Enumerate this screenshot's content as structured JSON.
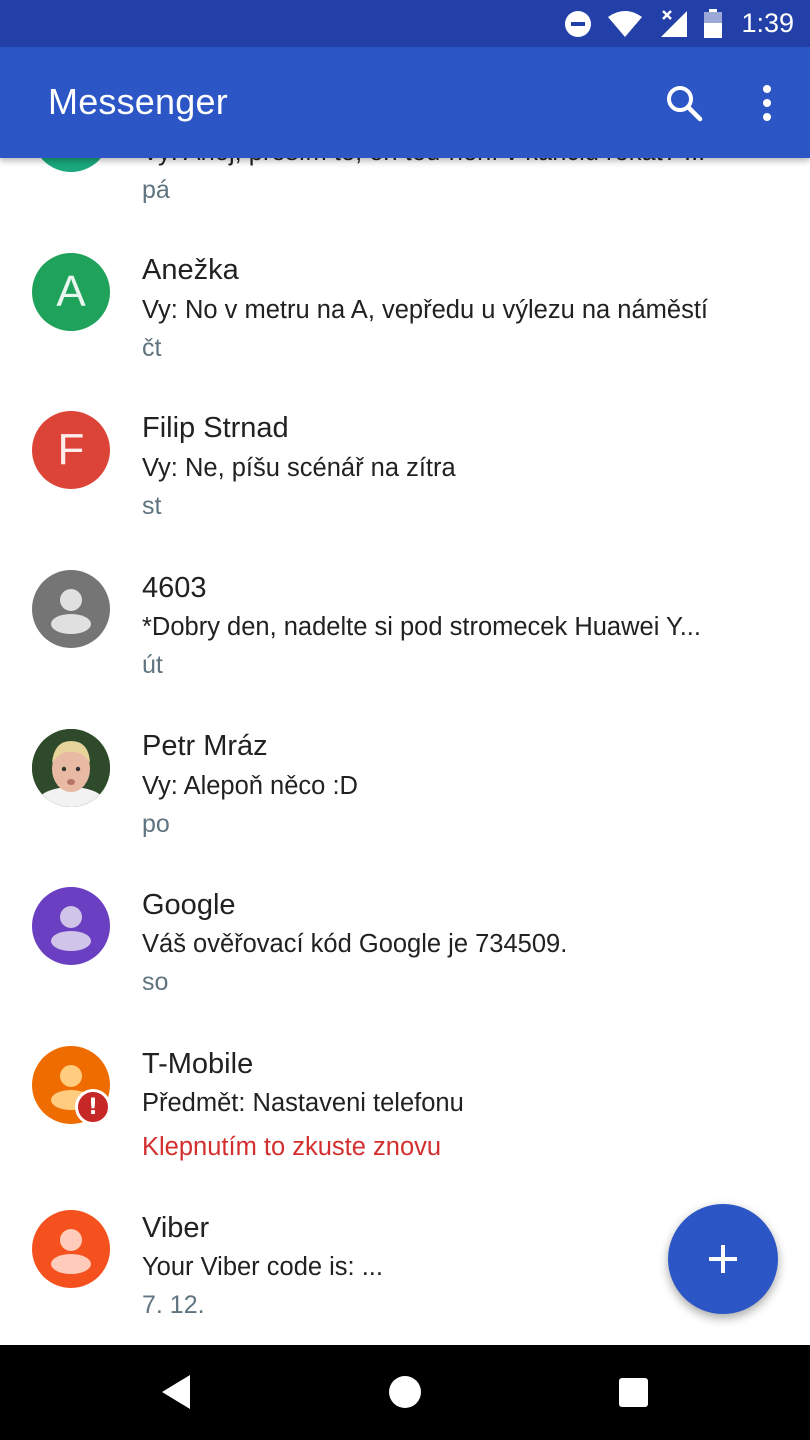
{
  "status_bar": {
    "time": "1:39",
    "icons": [
      "do-not-disturb-icon",
      "wifi-icon",
      "cell-signal-icon",
      "battery-icon"
    ]
  },
  "app_bar": {
    "title": "Messenger",
    "actions": [
      "search-icon",
      "more-vert-icon"
    ]
  },
  "conversations": [
    {
      "name": "",
      "snippet": "Vy: Ahoj, prosím tě, on teď není v kanclu řekat? ...",
      "time": "pá",
      "avatar": {
        "type": "letter",
        "letter": "",
        "color": "#1aa87c"
      }
    },
    {
      "name": "Anežka",
      "snippet": "Vy: No v metru na A, vepředu u výlezu na náměstí",
      "time": "čt",
      "avatar": {
        "type": "letter",
        "letter": "A",
        "color": "#1fa35a"
      }
    },
    {
      "name": "Filip Strnad",
      "snippet": "Vy: Ne, píšu scénář na zítra",
      "time": "st",
      "avatar": {
        "type": "letter",
        "letter": "F",
        "color": "#db4437"
      }
    },
    {
      "name": "4603",
      "snippet": "*Dobry den, nadelte si pod stromecek Huawei Y...",
      "time": "út",
      "avatar": {
        "type": "person",
        "color": "#757575"
      }
    },
    {
      "name": "Petr Mráz",
      "snippet": "Vy: Alepoň něco :D",
      "time": "po",
      "avatar": {
        "type": "photo",
        "color": "#2e4a2a"
      }
    },
    {
      "name": "Google",
      "snippet": "Váš ověřovací kód Google je 734509.",
      "time": "so",
      "avatar": {
        "type": "person",
        "color": "#6a3fc1"
      }
    },
    {
      "name": "T-Mobile",
      "snippet": "Předmět: Nastaveni telefonu",
      "time": "",
      "error": "Klepnutím to zkuste znovu",
      "avatar": {
        "type": "person",
        "color": "#ef6c00"
      },
      "badge": "!"
    },
    {
      "name": "Viber",
      "snippet": "Your Viber code is: ...",
      "time": "7. 12.",
      "avatar": {
        "type": "person",
        "color": "#f4511e"
      }
    }
  ],
  "fab": {
    "icon": "add-icon",
    "accent": "#2c56c5"
  },
  "nav_bar": {
    "icons": [
      "back-icon",
      "home-icon",
      "recents-icon"
    ]
  }
}
